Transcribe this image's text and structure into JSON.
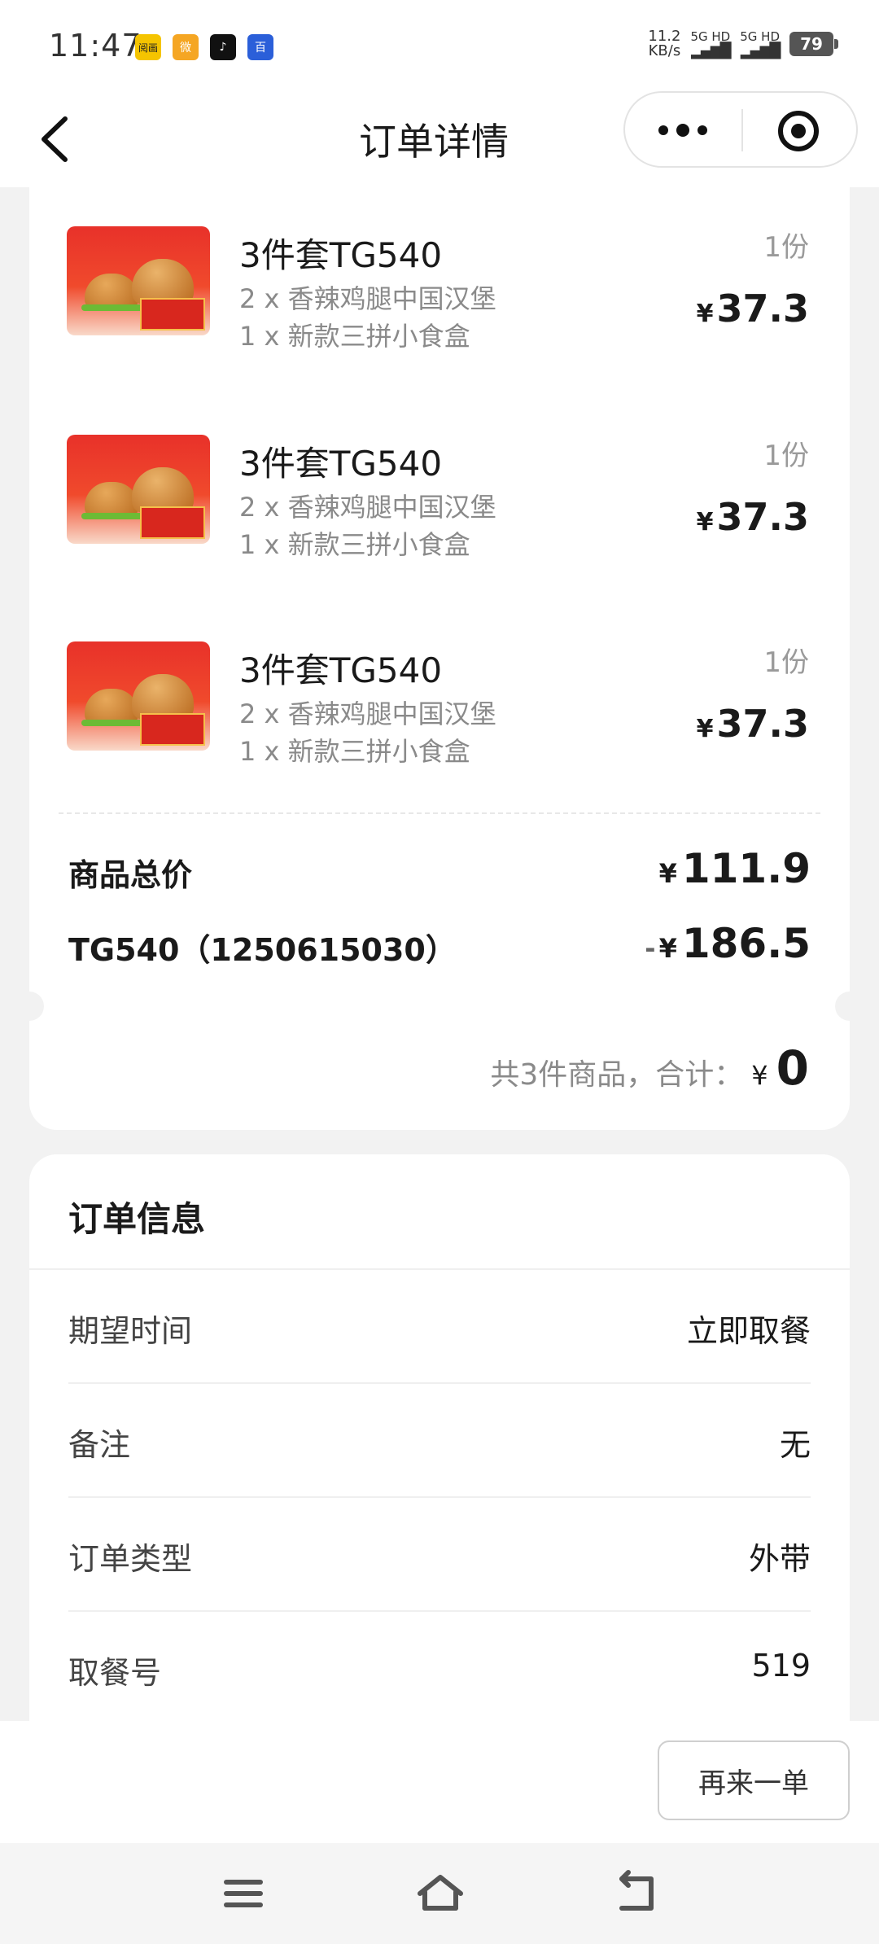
{
  "status_bar": {
    "time": "11:47",
    "app_icons": [
      {
        "name": "picture-app-icon",
        "label": "阅画",
        "color": "#f5c400"
      },
      {
        "name": "weibo-icon",
        "label": "微",
        "color": "#f5a623"
      },
      {
        "name": "tiktok-icon",
        "label": "♪",
        "color": "#111111"
      },
      {
        "name": "baidu-icon",
        "label": "百",
        "color": "#2b5fd9"
      }
    ],
    "net_speed_value": "11.2",
    "net_speed_unit": "KB/s",
    "signal1_label": "5G HD",
    "signal2_label": "5G HD",
    "battery": "79"
  },
  "nav": {
    "title": "订单详情"
  },
  "products": [
    {
      "name": "3件套TG540",
      "items": [
        "2 x 香辣鸡腿中国汉堡",
        "1 x 新款三拼小食盒"
      ],
      "qty": "1份",
      "currency": "¥",
      "price": "37.3"
    },
    {
      "name": "3件套TG540",
      "items": [
        "2 x 香辣鸡腿中国汉堡",
        "1 x 新款三拼小食盒"
      ],
      "qty": "1份",
      "currency": "¥",
      "price": "37.3"
    },
    {
      "name": "3件套TG540",
      "items": [
        "2 x 香辣鸡腿中国汉堡",
        "1 x 新款三拼小食盒"
      ],
      "qty": "1份",
      "currency": "¥",
      "price": "37.3"
    }
  ],
  "summary": {
    "goods_total_label": "商品总价",
    "goods_total_currency": "¥",
    "goods_total_value": "111.9",
    "discount_label": "TG540（1250615030）",
    "discount_sign": "-",
    "discount_currency": "¥",
    "discount_value": "186.5",
    "total_label": "共3件商品，合计：",
    "total_currency": "¥",
    "total_value": "0"
  },
  "order_info": {
    "title": "订单信息",
    "rows": [
      {
        "label": "期望时间",
        "value": "立即取餐"
      },
      {
        "label": "备注",
        "value": "无"
      },
      {
        "label": "订单类型",
        "value": "外带"
      },
      {
        "label": "取餐号",
        "value": "519"
      }
    ]
  },
  "actions": {
    "reorder_label": "再来一单"
  }
}
